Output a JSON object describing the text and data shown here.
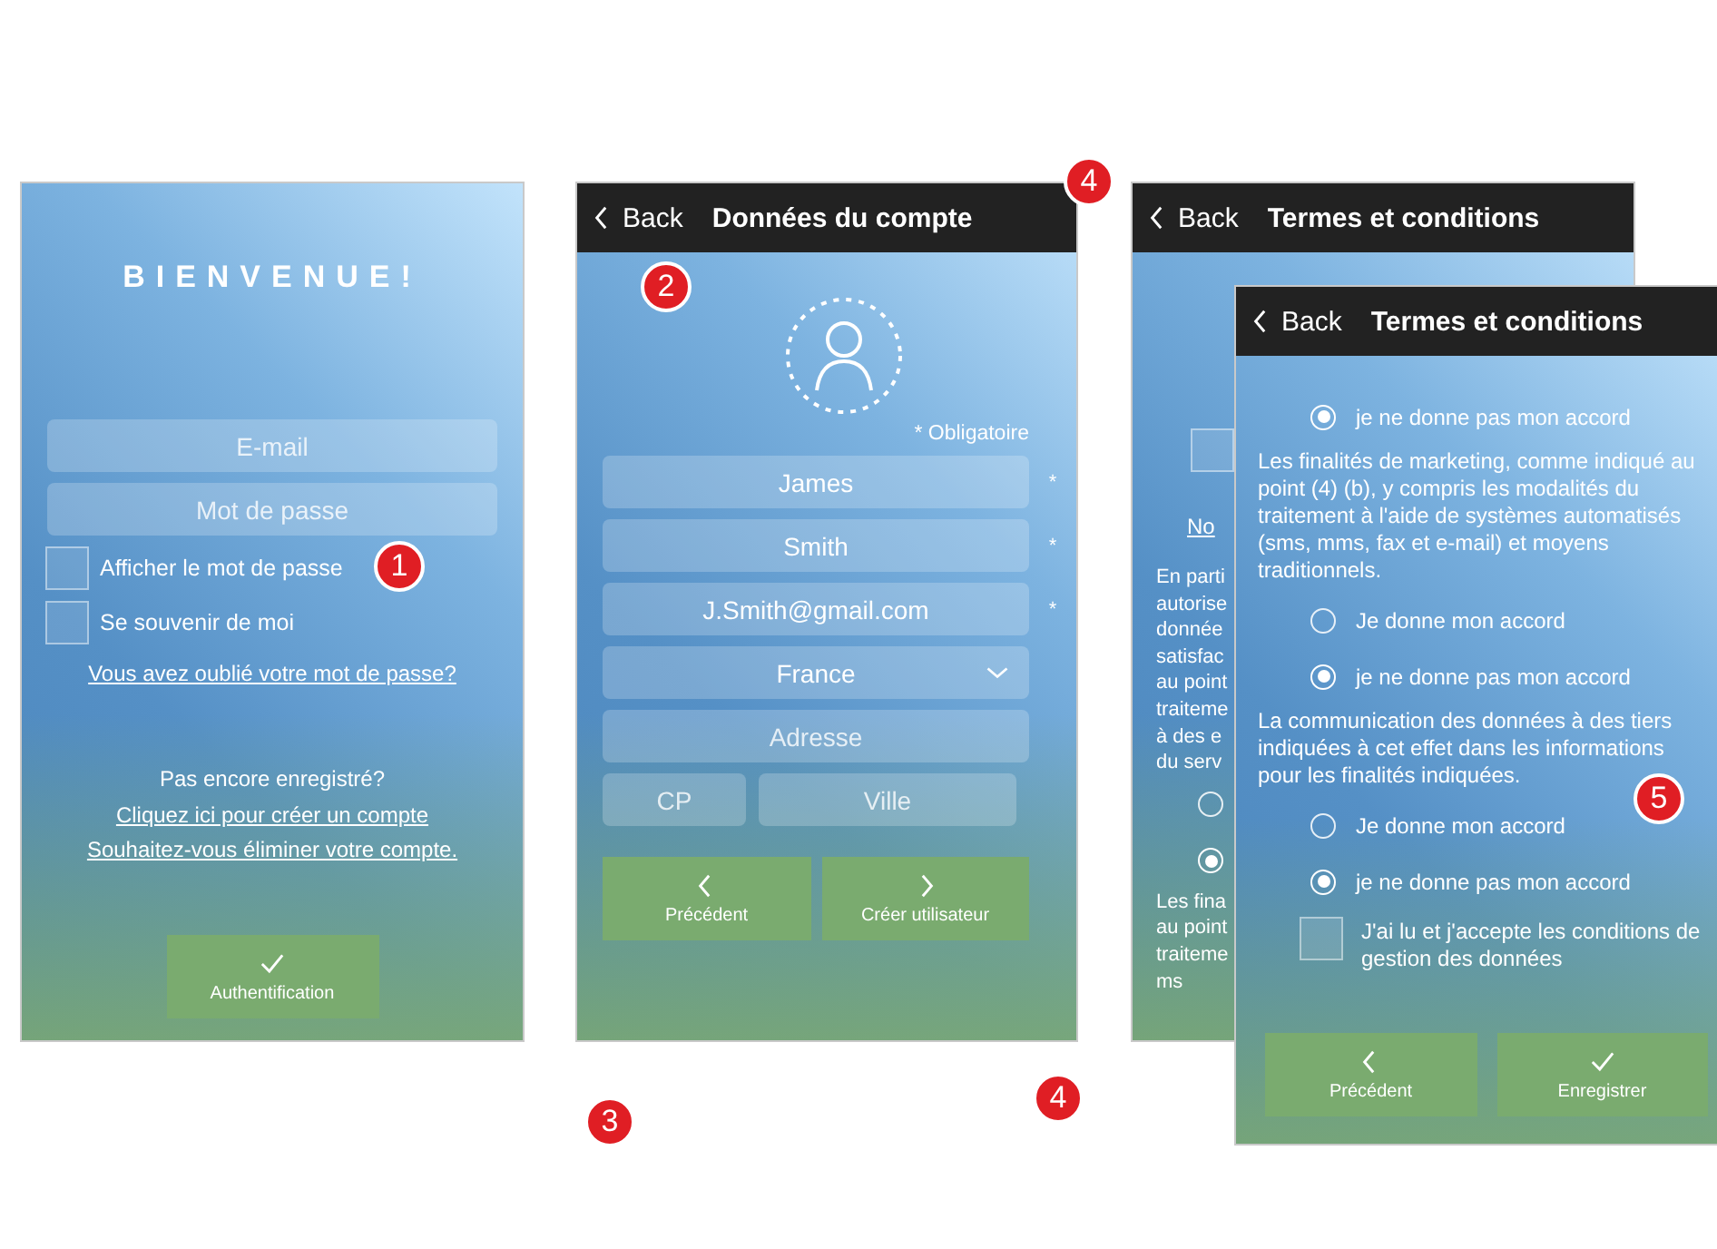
{
  "login": {
    "title": "BIENVENUE!",
    "email_field": {
      "placeholder": "E-mail"
    },
    "password_field": {
      "placeholder": "Mot de passe"
    },
    "checkboxes": [
      {
        "label": "Afficher le mot de passe",
        "checked": false
      },
      {
        "label": "Se souvenir de moi",
        "checked": false
      }
    ],
    "forgot_link": "Vous avez oublié votre mot de passe?",
    "register_prompt": "Pas encore enregistré?",
    "create_link": "Cliquez ici pour créer un compte",
    "delete_link": "Souhaitez-vous éliminer votre compte.",
    "button": {
      "kind": "confirm",
      "label": "Authentification"
    }
  },
  "account": {
    "back_label": "Back",
    "title": "Données du compte",
    "required_note": "* Obligatoire",
    "fields": [
      {
        "kind": "text",
        "value": "James",
        "mark": "*"
      },
      {
        "kind": "text",
        "value": "Smith",
        "mark": "*"
      },
      {
        "kind": "text",
        "value": "J.Smith@gmail.com",
        "mark": "*"
      },
      {
        "kind": "select",
        "value": "France"
      },
      {
        "kind": "text",
        "placeholder": "Adresse"
      }
    ],
    "postal_fields": [
      {
        "placeholder": "CP"
      },
      {
        "placeholder": "Ville"
      }
    ],
    "buttons": [
      {
        "kind": "back",
        "label": "Précédent"
      },
      {
        "kind": "next",
        "label": "Créer utilisateur"
      }
    ]
  },
  "terms_back": {
    "back_label": "Back",
    "title": "Termes et conditions",
    "fragments": [
      {
        "kind": "checkbox",
        "checked": false
      },
      {
        "kind": "link",
        "text": "No"
      },
      {
        "kind": "text",
        "text": "En parti"
      },
      {
        "kind": "text",
        "text": "autorise"
      },
      {
        "kind": "text",
        "text": "donnée"
      },
      {
        "kind": "text",
        "text": "satisfac"
      },
      {
        "kind": "text",
        "text": "au point"
      },
      {
        "kind": "text",
        "text": "traiteme"
      },
      {
        "kind": "text",
        "text": "à des e"
      },
      {
        "kind": "text",
        "text": "du serv"
      },
      {
        "kind": "radio",
        "selected": false
      },
      {
        "kind": "radio",
        "selected": true
      },
      {
        "kind": "text",
        "text": "Les fina"
      },
      {
        "kind": "text",
        "text": "au point"
      },
      {
        "kind": "text",
        "text": "traiteme"
      },
      {
        "kind": "text",
        "text": "ms"
      }
    ]
  },
  "terms_front": {
    "back_label": "Back",
    "title": "Termes et conditions",
    "items": [
      {
        "kind": "radio",
        "label": "je ne donne pas mon accord",
        "selected": true
      },
      {
        "kind": "paragraph",
        "text": "Les finalités de marketing, comme indiqué au point (4) (b), y compris les modalités du traitement à l'aide de systèmes automatisés (sms, mms, fax et e-mail) et moyens traditionnels."
      },
      {
        "kind": "radio",
        "label": "Je donne mon accord",
        "selected": false
      },
      {
        "kind": "radio",
        "label": "je ne donne pas mon accord",
        "selected": true
      },
      {
        "kind": "paragraph",
        "text": "La communication des données à des tiers indiquées à cet effet dans les informations pour les finalités indiquées."
      },
      {
        "kind": "radio",
        "label": "Je donne mon accord",
        "selected": false
      },
      {
        "kind": "radio",
        "label": "je ne donne pas mon accord",
        "selected": true
      },
      {
        "kind": "checkbox",
        "label": "J'ai lu et j'accepte les conditions de gestion des données",
        "checked": false
      }
    ],
    "buttons": [
      {
        "kind": "back",
        "label": "Précédent"
      },
      {
        "kind": "confirm",
        "label": "Enregistrer"
      }
    ]
  },
  "step_markers": [
    {
      "label": "1"
    },
    {
      "label": "2"
    },
    {
      "label": "3"
    },
    {
      "label": "4"
    },
    {
      "label": "4"
    },
    {
      "label": "5"
    }
  ]
}
